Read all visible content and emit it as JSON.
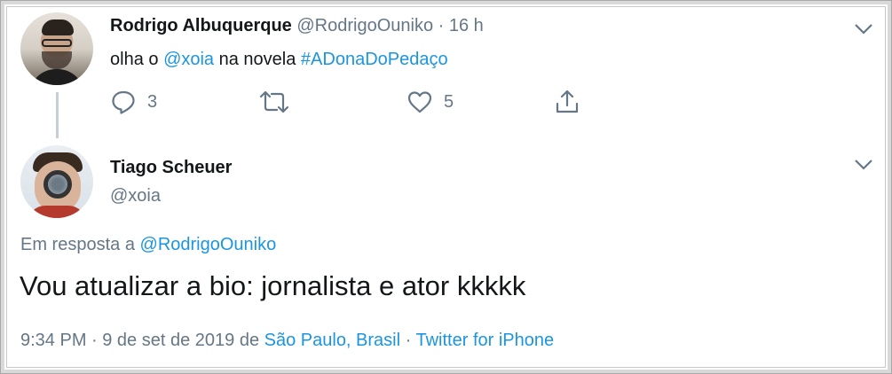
{
  "tweet1": {
    "display_name": "Rodrigo Albuquerque",
    "handle": "@RodrigoOuniko",
    "separator": "·",
    "time": "16 h",
    "text_prefix": "olha o ",
    "mention": "@xoia",
    "text_middle": " na novela ",
    "hashtag": "#ADonaDoPedaço",
    "reply_count": "3",
    "like_count": "5"
  },
  "tweet2": {
    "display_name": "Tiago Scheuer",
    "handle": "@xoia",
    "reply_to_prefix": "Em resposta a ",
    "reply_to_handle": "@RodrigoOuniko",
    "text": "Vou atualizar a bio: jornalista e ator kkkkk",
    "timestamp": "9:34 PM · 9 de set de 2019 de ",
    "location": "São Paulo, Brasil",
    "meta_separator": " · ",
    "client": "Twitter for iPhone"
  },
  "icons": {
    "reply": "reply-icon",
    "retweet": "retweet-icon",
    "like": "heart-icon",
    "share": "share-icon",
    "menu": "chevron-down-icon"
  },
  "colors": {
    "link": "#1b95e0",
    "muted": "#657786",
    "text": "#14171a"
  }
}
